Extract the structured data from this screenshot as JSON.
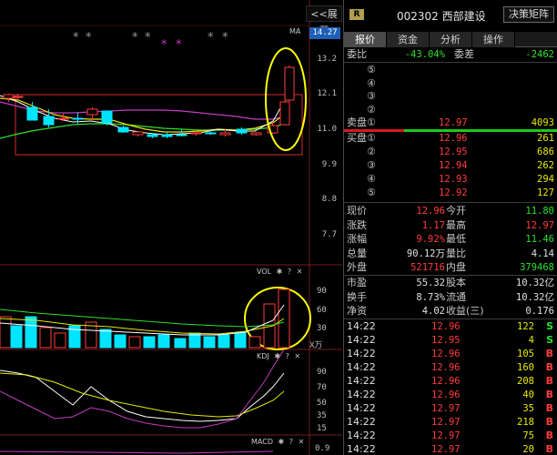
{
  "chart": {
    "expand_label": "<<展开",
    "ma_label": "MA",
    "current_price_tag": "14.27",
    "price_axis": [
      "13.2",
      "12.1",
      "11.0",
      "9.9",
      "8.8",
      "7.7"
    ],
    "vol_header": "VOL",
    "vol_axis": [
      "90",
      "60",
      "30"
    ],
    "vol_unit": "X万",
    "kdj_header": "KDJ",
    "kdj_axis": [
      "90",
      "70",
      "50",
      "35",
      "15"
    ],
    "macd_header": "MACD",
    "macd_axis": [
      "0.9"
    ],
    "header_icons": [
      "gear-icon",
      "help-icon",
      "close-icon"
    ],
    "markers": [
      "*",
      "*",
      "*",
      "*",
      "*",
      "*",
      "*",
      "*"
    ],
    "colors": {
      "up": "#ff3c3c",
      "down": "#00e5ff",
      "ma5": "#ffffff",
      "ma10": "#e8e800",
      "ma20": "#c13cc1",
      "ma30": "#2ee02e",
      "highlight": "#ffff00"
    }
  },
  "header": {
    "badge": "R",
    "stock_code": "002302 西部建设",
    "decision_button": "决策矩阵"
  },
  "tabs": [
    "报价",
    "资金",
    "分析",
    "操作"
  ],
  "active_tab": "报价",
  "order_ratio": {
    "label_ratio": "委比",
    "ratio": "-43.04%",
    "label_diff": "委差",
    "diff": "-2462"
  },
  "sell_orders": [
    {
      "label": "⑤",
      "price": "",
      "volume": ""
    },
    {
      "label": "④",
      "price": "",
      "volume": ""
    },
    {
      "label": "③",
      "price": "",
      "volume": ""
    },
    {
      "label": "②",
      "price": "",
      "volume": ""
    },
    {
      "label": "卖盘①",
      "price": "12.97",
      "volume": "4093"
    }
  ],
  "buy_orders": [
    {
      "label": "买盘①",
      "price": "12.96",
      "volume": "261"
    },
    {
      "label": "②",
      "price": "12.95",
      "volume": "686"
    },
    {
      "label": "③",
      "price": "12.94",
      "volume": "262"
    },
    {
      "label": "④",
      "price": "12.93",
      "volume": "294"
    },
    {
      "label": "⑤",
      "price": "12.92",
      "volume": "127"
    }
  ],
  "quote": [
    {
      "l1": "现价",
      "v1": "12.96",
      "l2": "今开",
      "v2": "11.80"
    },
    {
      "l1": "涨跌",
      "v1": "1.17",
      "l2": "最高",
      "v2": "12.97"
    },
    {
      "l1": "涨幅",
      "v1": "9.92%",
      "l2": "最低",
      "v2": "11.46"
    },
    {
      "l1": "总量",
      "v1": "90.12万",
      "l2": "量比",
      "v2": "4.14"
    },
    {
      "l1": "外盘",
      "v1": "521716",
      "l2": "内盘",
      "v2": "379468"
    }
  ],
  "finance": [
    {
      "l1": "市盈",
      "v1": "55.32",
      "l2": "股本",
      "v2": "10.32亿"
    },
    {
      "l1": "换手",
      "v1": "8.73%",
      "l2": "流通",
      "v2": "10.32亿"
    },
    {
      "l1": "净资",
      "v1": "4.02",
      "l2": "收益(三)",
      "v2": "0.176"
    }
  ],
  "trades": [
    {
      "time": "14:22",
      "price": "12.96",
      "volume": "122",
      "side": "S"
    },
    {
      "time": "14:22",
      "price": "12.95",
      "volume": "4",
      "side": "S"
    },
    {
      "time": "14:22",
      "price": "12.96",
      "volume": "105",
      "side": "B"
    },
    {
      "time": "14:22",
      "price": "12.96",
      "volume": "160",
      "side": "B"
    },
    {
      "time": "14:22",
      "price": "12.96",
      "volume": "208",
      "side": "B"
    },
    {
      "time": "14:22",
      "price": "12.96",
      "volume": "40",
      "side": "B"
    },
    {
      "time": "14:22",
      "price": "12.97",
      "volume": "35",
      "side": "B"
    },
    {
      "time": "14:22",
      "price": "12.97",
      "volume": "218",
      "side": "B"
    },
    {
      "time": "14:22",
      "price": "12.97",
      "volume": "75",
      "side": "B"
    },
    {
      "time": "14:22",
      "price": "12.97",
      "volume": "20",
      "side": "B"
    }
  ]
}
